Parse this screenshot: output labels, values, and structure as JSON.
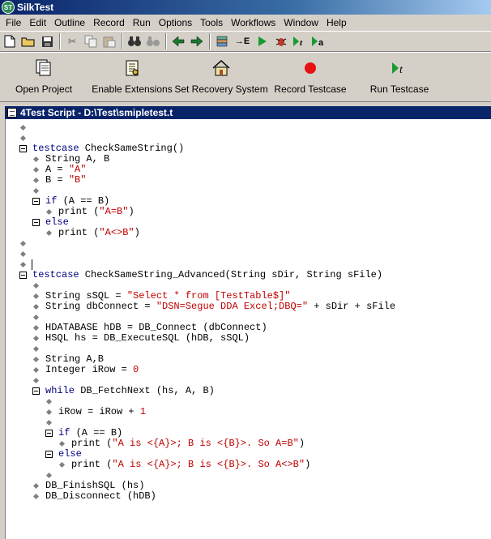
{
  "app": {
    "title": "SilkTest",
    "logo_text": "ST"
  },
  "menu": [
    "File",
    "Edit",
    "Outline",
    "Record",
    "Run",
    "Options",
    "Tools",
    "Workflows",
    "Window",
    "Help"
  ],
  "toolbar": {
    "buttons": [
      "new-file",
      "open-folder",
      "save",
      "cut",
      "copy",
      "paste",
      "find",
      "replace",
      "back",
      "forward",
      "compile",
      "goto-error",
      "run",
      "debug",
      "run-testcase",
      "record-actions"
    ]
  },
  "workflow_bar": {
    "buttons": [
      {
        "label": "Open Project",
        "icon": "project-icon"
      },
      {
        "label": "Enable Extensions",
        "icon": "extensions-icon"
      },
      {
        "label": "Set Recovery System",
        "icon": "house-icon"
      },
      {
        "label": "Record Testcase",
        "icon": "record-icon"
      },
      {
        "label": "Run Testcase",
        "icon": "run-testcase-icon"
      }
    ]
  },
  "document": {
    "title": "4Test Script - D:\\Test\\smipletest.t",
    "lines": [
      {
        "indent": 0,
        "marker": "bullet",
        "tokens": []
      },
      {
        "indent": 0,
        "marker": "bullet",
        "tokens": []
      },
      {
        "indent": 0,
        "marker": "fold",
        "tokens": [
          {
            "t": "testcase",
            "c": "kw"
          },
          {
            "t": " CheckSameString()"
          }
        ]
      },
      {
        "indent": 1,
        "marker": "bullet",
        "tokens": [
          {
            "t": "String A, B"
          }
        ]
      },
      {
        "indent": 1,
        "marker": "bullet",
        "tokens": [
          {
            "t": "A = "
          },
          {
            "t": "\"A\"",
            "c": "str"
          }
        ]
      },
      {
        "indent": 1,
        "marker": "bullet",
        "tokens": [
          {
            "t": "B = "
          },
          {
            "t": "\"B\"",
            "c": "str"
          }
        ]
      },
      {
        "indent": 1,
        "marker": "bullet",
        "tokens": []
      },
      {
        "indent": 1,
        "marker": "fold",
        "tokens": [
          {
            "t": "if",
            "c": "kw"
          },
          {
            "t": " (A == B)"
          }
        ]
      },
      {
        "indent": 2,
        "marker": "bullet",
        "tokens": [
          {
            "t": "print ("
          },
          {
            "t": "\"A=B\"",
            "c": "str"
          },
          {
            "t": ")"
          }
        ]
      },
      {
        "indent": 1,
        "marker": "fold",
        "tokens": [
          {
            "t": "else",
            "c": "kw"
          }
        ]
      },
      {
        "indent": 2,
        "marker": "bullet",
        "tokens": [
          {
            "t": "print ("
          },
          {
            "t": "\"A<>B\"",
            "c": "str"
          },
          {
            "t": ")"
          }
        ]
      },
      {
        "indent": 0,
        "marker": "bullet",
        "tokens": []
      },
      {
        "indent": 0,
        "marker": "bullet",
        "tokens": []
      },
      {
        "indent": 0,
        "marker": "bullet",
        "tokens": [],
        "caret": true
      },
      {
        "indent": 0,
        "marker": "fold",
        "tokens": [
          {
            "t": "testcase",
            "c": "kw"
          },
          {
            "t": " CheckSameString_Advanced(String sDir, String sFile)"
          }
        ]
      },
      {
        "indent": 1,
        "marker": "bullet",
        "tokens": []
      },
      {
        "indent": 1,
        "marker": "bullet",
        "tokens": [
          {
            "t": "String sSQL = "
          },
          {
            "t": "\"Select * from [TestTable$]\"",
            "c": "str"
          }
        ]
      },
      {
        "indent": 1,
        "marker": "bullet",
        "tokens": [
          {
            "t": "String dbConnect = "
          },
          {
            "t": "\"DSN=Segue DDA Excel;DBQ=\"",
            "c": "str"
          },
          {
            "t": " + sDir + sFile"
          }
        ]
      },
      {
        "indent": 1,
        "marker": "bullet",
        "tokens": []
      },
      {
        "indent": 1,
        "marker": "bullet",
        "tokens": [
          {
            "t": "HDATABASE hDB = DB_Connect (dbConnect)"
          }
        ]
      },
      {
        "indent": 1,
        "marker": "bullet",
        "tokens": [
          {
            "t": "HSQL hs = DB_ExecuteSQL (hDB, sSQL)"
          }
        ]
      },
      {
        "indent": 1,
        "marker": "bullet",
        "tokens": []
      },
      {
        "indent": 1,
        "marker": "bullet",
        "tokens": [
          {
            "t": "String A,B"
          }
        ]
      },
      {
        "indent": 1,
        "marker": "bullet",
        "tokens": [
          {
            "t": "Integer iRow = "
          },
          {
            "t": "0",
            "c": "num"
          }
        ]
      },
      {
        "indent": 1,
        "marker": "bullet",
        "tokens": []
      },
      {
        "indent": 1,
        "marker": "fold",
        "tokens": [
          {
            "t": "while",
            "c": "kw"
          },
          {
            "t": " DB_FetchNext (hs, A, B)"
          }
        ]
      },
      {
        "indent": 2,
        "marker": "bullet",
        "tokens": []
      },
      {
        "indent": 2,
        "marker": "bullet",
        "tokens": [
          {
            "t": "iRow = iRow + "
          },
          {
            "t": "1",
            "c": "num"
          }
        ]
      },
      {
        "indent": 2,
        "marker": "bullet",
        "tokens": []
      },
      {
        "indent": 2,
        "marker": "fold",
        "tokens": [
          {
            "t": "if",
            "c": "kw"
          },
          {
            "t": " (A == B)"
          }
        ]
      },
      {
        "indent": 3,
        "marker": "bullet",
        "tokens": [
          {
            "t": "print ("
          },
          {
            "t": "\"A is <{A}>; B is <{B}>. So A=B\"",
            "c": "str"
          },
          {
            "t": ")"
          }
        ]
      },
      {
        "indent": 2,
        "marker": "fold",
        "tokens": [
          {
            "t": "else",
            "c": "kw"
          }
        ]
      },
      {
        "indent": 3,
        "marker": "bullet",
        "tokens": [
          {
            "t": "print ("
          },
          {
            "t": "\"A is <{A}>; B is <{B}>. So A<>B\"",
            "c": "str"
          },
          {
            "t": ")"
          }
        ]
      },
      {
        "indent": 2,
        "marker": "bullet",
        "tokens": []
      },
      {
        "indent": 1,
        "marker": "bullet",
        "tokens": [
          {
            "t": "DB_FinishSQL (hs)"
          }
        ]
      },
      {
        "indent": 1,
        "marker": "bullet",
        "tokens": [
          {
            "t": "DB_Disconnect (hDB)"
          }
        ]
      }
    ]
  },
  "colors": {
    "title_gradient_start": "#0a246a",
    "title_gradient_end": "#a6caf0",
    "doc_title_bg": "#0a246a",
    "keyword": "#000080",
    "string_literal": "#c00000",
    "editor_bg": "#ffffff",
    "chrome_bg": "#d4d0c8"
  }
}
